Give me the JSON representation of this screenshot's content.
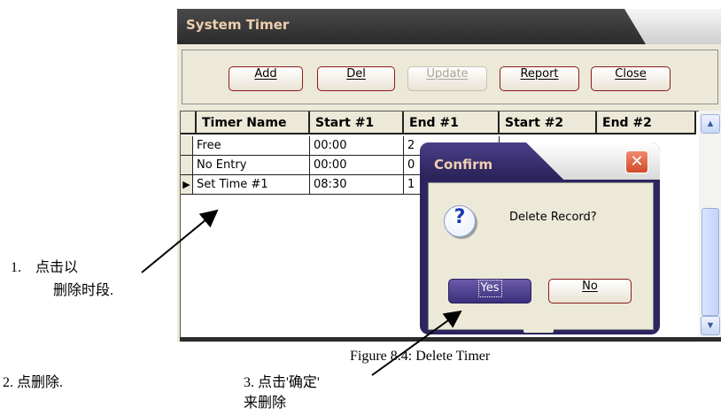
{
  "window": {
    "title": "System Timer"
  },
  "toolbar": {
    "add": "Add",
    "del": "Del",
    "update": "Update",
    "report": "Report",
    "close": "Close"
  },
  "grid": {
    "columns": [
      "Timer Name",
      "Start #1",
      "End #1",
      "Start #2",
      "End #2"
    ],
    "rows": [
      {
        "name": "Free",
        "start1": "00:00",
        "end1": "2"
      },
      {
        "name": "No Entry",
        "start1": "00:00",
        "end1": "0"
      },
      {
        "name": "Set Time #1",
        "start1": "08:30",
        "end1": "1"
      }
    ],
    "row_pointer_glyph": "▶"
  },
  "dialog": {
    "title": "Confirm",
    "message": "Delete Record?",
    "yes": "Yes",
    "no": "No",
    "icon": "question-icon",
    "close_glyph": "✕"
  },
  "annotations": {
    "step1_line1": "1.    点击以",
    "step1_line2": "删除时段.",
    "step2": "2. 点删除.",
    "step3_line1": "3. 点击'确定'",
    "step3_line2": "来删除"
  },
  "caption": "Figure 8.4: Delete Timer",
  "colors": {
    "title_text": "#efcfb0",
    "dialog_frame": "#2d2560",
    "button_border": "#8b1a1a"
  }
}
